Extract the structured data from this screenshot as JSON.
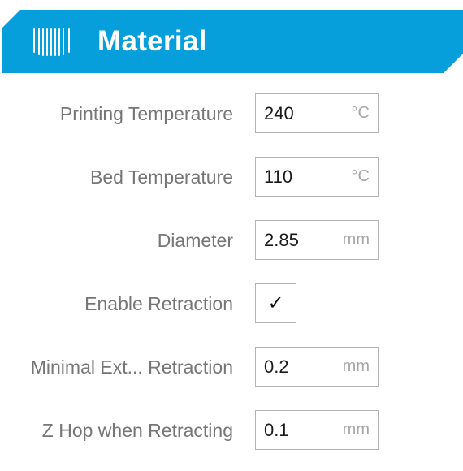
{
  "header": {
    "title": "Material",
    "icon": "material-spool-icon",
    "accent_color": "#069fdc"
  },
  "fields": [
    {
      "label": "Printing Temperature",
      "value": "240",
      "unit": "°C"
    },
    {
      "label": "Bed Temperature",
      "value": "110",
      "unit": "°C"
    },
    {
      "label": "Diameter",
      "value": "2.85",
      "unit": "mm"
    },
    {
      "label": "Enable Retraction",
      "checked": true,
      "check_glyph": "✓"
    },
    {
      "label": "Minimal Ext... Retraction",
      "value": "0.2",
      "unit": "mm"
    },
    {
      "label": "Z Hop when Retracting",
      "value": "0.1",
      "unit": "mm"
    }
  ]
}
